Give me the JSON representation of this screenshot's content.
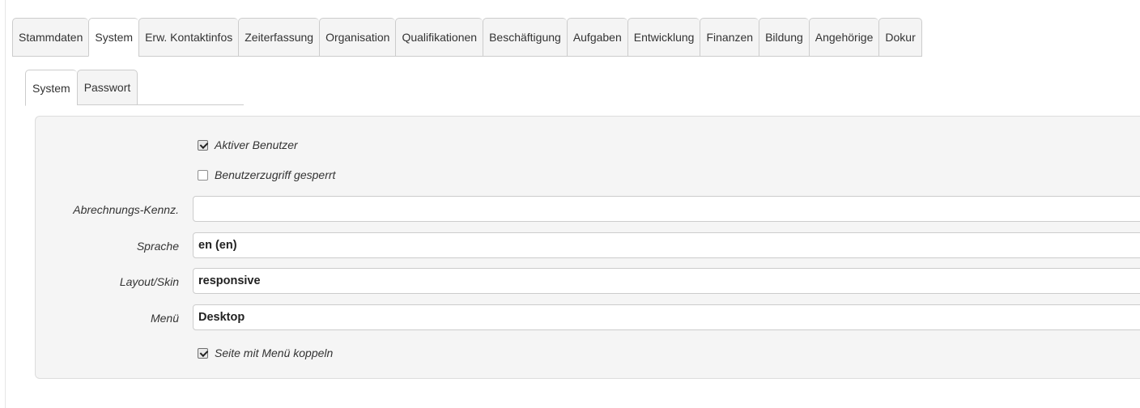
{
  "main_tabs": [
    {
      "label": "Stammdaten",
      "active": false
    },
    {
      "label": "System",
      "active": true
    },
    {
      "label": "Erw. Kontaktinfos",
      "active": false
    },
    {
      "label": "Zeiterfassung",
      "active": false
    },
    {
      "label": "Organisation",
      "active": false
    },
    {
      "label": "Qualifikationen",
      "active": false
    },
    {
      "label": "Beschäftigung",
      "active": false
    },
    {
      "label": "Aufgaben",
      "active": false
    },
    {
      "label": "Entwicklung",
      "active": false
    },
    {
      "label": "Finanzen",
      "active": false
    },
    {
      "label": "Bildung",
      "active": false
    },
    {
      "label": "Angehörige",
      "active": false
    },
    {
      "label": "Dokur",
      "active": false
    }
  ],
  "sub_tabs": [
    {
      "label": "System",
      "active": true
    },
    {
      "label": "Passwort",
      "active": false
    }
  ],
  "form": {
    "active_user": {
      "label": "Aktiver Benutzer",
      "checked": true
    },
    "access_locked": {
      "label": "Benutzerzugriff gesperrt",
      "checked": false
    },
    "billing_code": {
      "label": "Abrechnungs-Kennz.",
      "value": ""
    },
    "language": {
      "label": "Sprache",
      "value": "en (en)"
    },
    "layout_skin": {
      "label": "Layout/Skin",
      "value": "responsive"
    },
    "menu": {
      "label": "Menü",
      "value": "Desktop"
    },
    "link_menu": {
      "label": "Seite mit Menü koppeln",
      "checked": true
    }
  }
}
